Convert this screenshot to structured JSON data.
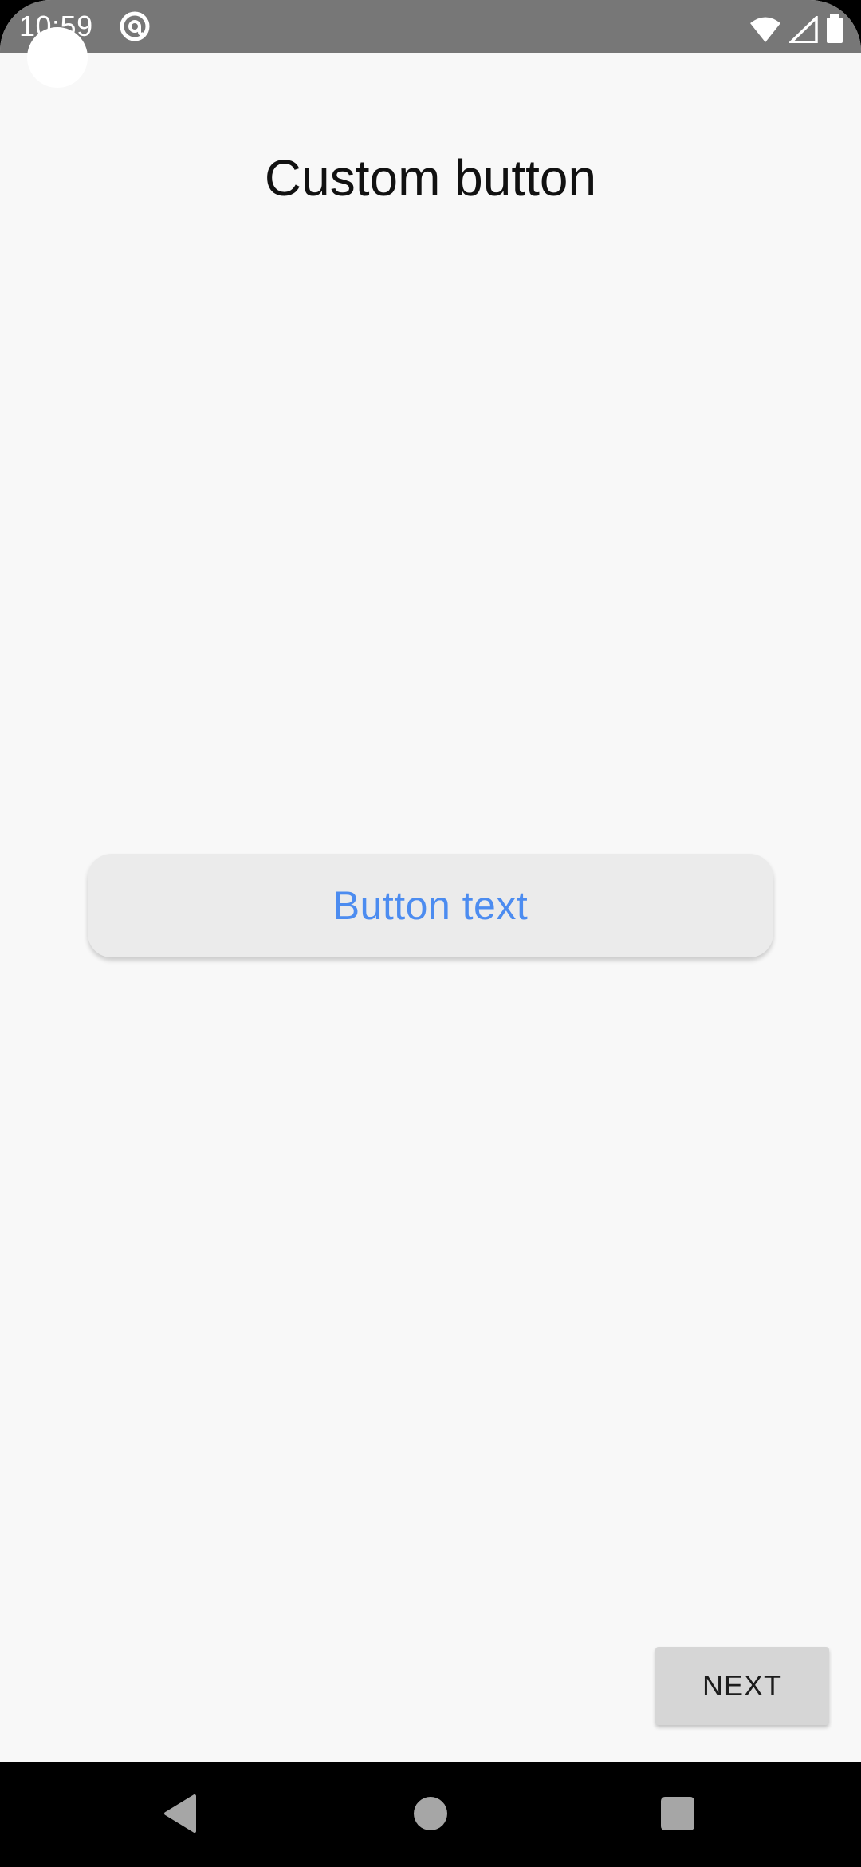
{
  "status_bar": {
    "time": "10:59",
    "icons": [
      "at-sign-icon",
      "wifi-icon",
      "signal-icon",
      "battery-icon"
    ]
  },
  "page": {
    "title": "Custom button"
  },
  "custom_button": {
    "label": "Button text",
    "text_color": "#4c8cf0",
    "background": "#ebebeb"
  },
  "next_button": {
    "label": "NEXT"
  },
  "nav_bar": {
    "items": [
      "back-icon",
      "home-icon",
      "recents-icon"
    ]
  }
}
